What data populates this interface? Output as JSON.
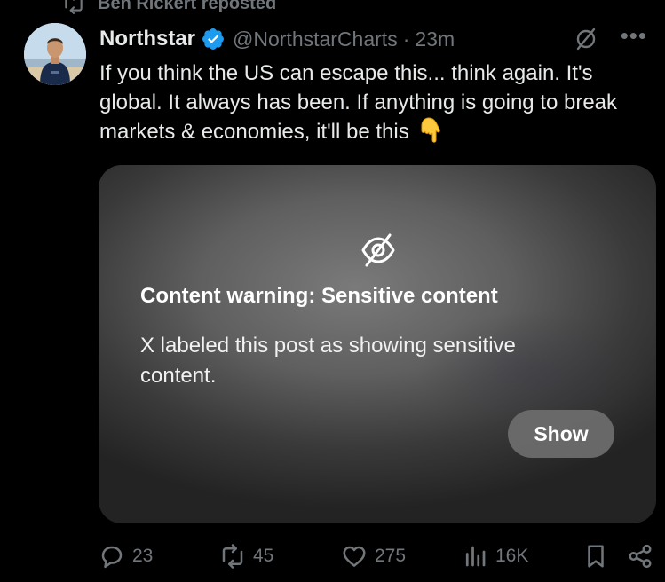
{
  "repost": {
    "label": "Ben Rickert reposted"
  },
  "post": {
    "author_name": "Northstar",
    "handle": "@NorthstarCharts",
    "separator": "·",
    "timestamp": "23m",
    "text": "If you think the US can escape this... think again. It's global. It always has been. If anything is going to break markets & economies, it'll be this",
    "emoji": "backhand-index-pointing-down"
  },
  "media": {
    "warning_title": "Content warning: Sensitive content",
    "warning_description": "X labeled this post as showing sensitive content.",
    "show_label": "Show"
  },
  "actions": {
    "replies": "23",
    "reposts": "45",
    "likes": "275",
    "views": "16K"
  },
  "colors": {
    "background": "#000000",
    "text_primary": "#e7e9ea",
    "text_secondary": "#71767b",
    "verified_blue": "#1d9bf0",
    "show_button": "#6e6e6e"
  },
  "icons": {
    "repost": "repost-icon",
    "verified": "verified-badge-icon",
    "grok": "grok-icon",
    "more": "more-icon",
    "hidden": "eye-slash-icon",
    "reply": "reply-icon",
    "retweet": "repost-icon",
    "like": "heart-icon",
    "views": "views-icon",
    "bookmark": "bookmark-icon",
    "share": "share-icon"
  }
}
